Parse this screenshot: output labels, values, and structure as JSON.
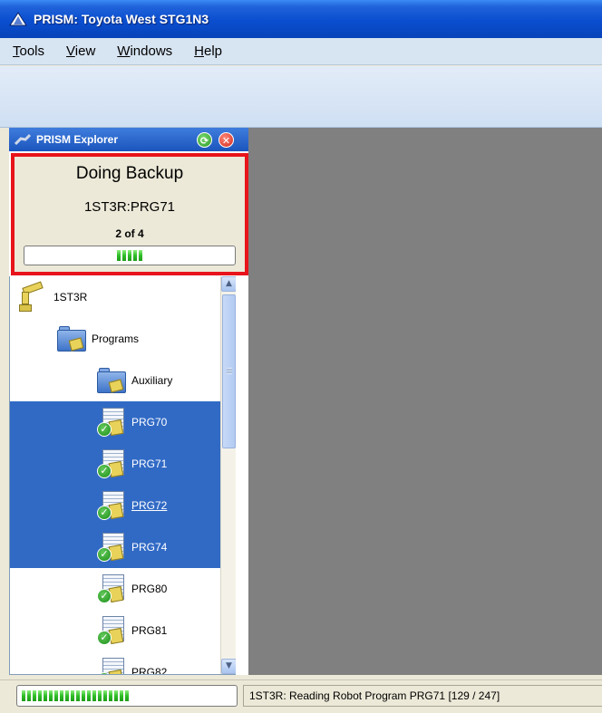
{
  "window": {
    "title": "PRISM: Toyota West STG1N3"
  },
  "menu": [
    {
      "label": "Tools"
    },
    {
      "label": "View"
    },
    {
      "label": "Windows"
    },
    {
      "label": "Help"
    }
  ],
  "explorer": {
    "title": "PRISM Explorer",
    "refresh_icon": "refresh-icon",
    "close_icon": "close-icon",
    "backup": {
      "heading": "Doing Backup",
      "target": "1ST3R:PRG71",
      "count": "2 of 4",
      "progress_fraction": 0.5
    },
    "tree": [
      {
        "label": "1ST3R",
        "icon": "robot-icon",
        "depth": 0,
        "selected": false
      },
      {
        "label": "Programs",
        "icon": "folder-icon",
        "depth": 1,
        "selected": false
      },
      {
        "label": "Auxiliary",
        "icon": "folder-icon",
        "depth": 2,
        "selected": false
      },
      {
        "label": "PRG70",
        "icon": "program-check-icon",
        "depth": 2,
        "selected": true
      },
      {
        "label": "PRG71",
        "icon": "program-check-icon",
        "depth": 2,
        "selected": true
      },
      {
        "label": "PRG72",
        "icon": "program-check-icon",
        "depth": 2,
        "selected": true,
        "link": true
      },
      {
        "label": "PRG74",
        "icon": "program-check-icon",
        "depth": 2,
        "selected": true
      },
      {
        "label": "PRG80",
        "icon": "program-check-icon",
        "depth": 2,
        "selected": false
      },
      {
        "label": "PRG81",
        "icon": "program-check-icon",
        "depth": 2,
        "selected": false
      },
      {
        "label": "PRG82",
        "icon": "program-check-icon",
        "depth": 2,
        "selected": false
      }
    ]
  },
  "status": {
    "text": "1ST3R: Reading Robot Program PRG71  [129 / 247]",
    "progress_fraction": 0.52
  },
  "colors": {
    "highlight_border": "#e8141b",
    "selection": "#316ac5",
    "progress_green": "#2fbd28",
    "workspace_gray": "#808080"
  }
}
